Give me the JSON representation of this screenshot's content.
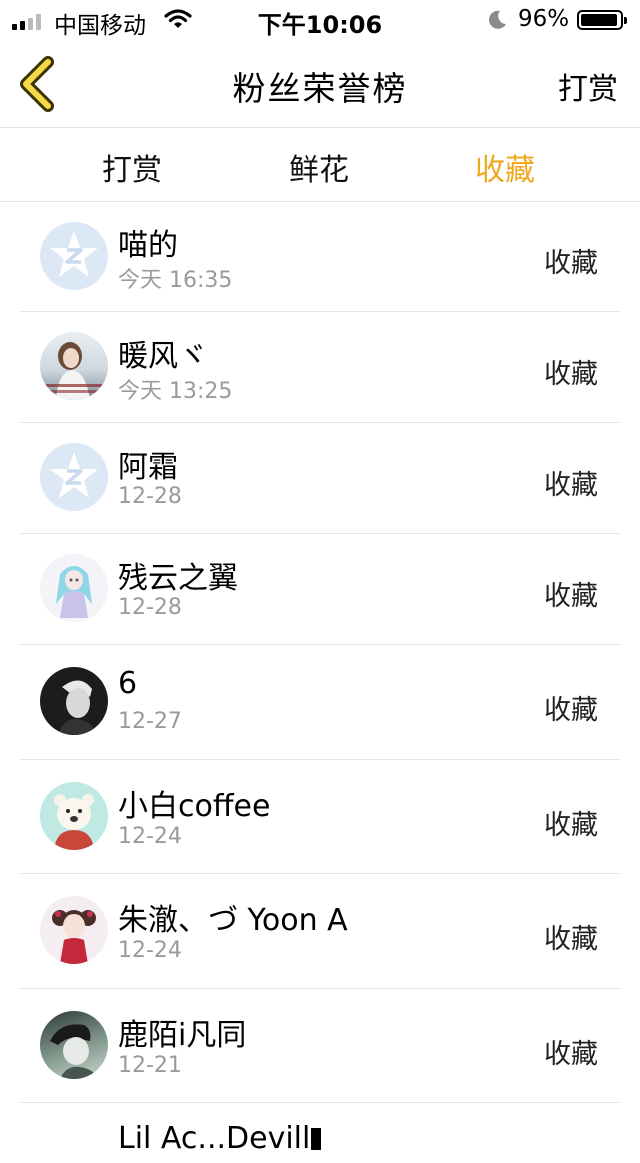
{
  "status_bar": {
    "carrier": "中国移动",
    "time": "下午10:06",
    "battery": "96%",
    "battery_level": 0.96,
    "icons": [
      "signal-icon",
      "wifi-icon",
      "moon-icon",
      "battery-icon"
    ]
  },
  "nav": {
    "title": "粉丝荣誉榜",
    "right_label": "打赏",
    "back_icon": "chevron-left-icon",
    "accent": "#f0a820"
  },
  "tabs": [
    {
      "label": "打赏",
      "active": false
    },
    {
      "label": "鲜花",
      "active": false
    },
    {
      "label": "收藏",
      "active": true
    }
  ],
  "list": [
    {
      "name": "喵的",
      "time": "今天 16:35",
      "action": "收藏",
      "avatar": "default-avatar-icon"
    },
    {
      "name": "暖风ヾ",
      "time": "今天 13:25",
      "action": "收藏",
      "avatar": "photo-avatar"
    },
    {
      "name": "阿霜",
      "time": "12-28",
      "action": "收藏",
      "avatar": "default-avatar-icon"
    },
    {
      "name": "残云之翼",
      "time": "12-28",
      "action": "收藏",
      "avatar": "anime-avatar"
    },
    {
      "name": "6",
      "time": "12-27",
      "action": "收藏",
      "avatar": "photo-avatar"
    },
    {
      "name": "小白coffee",
      "time": "12-24",
      "action": "收藏",
      "avatar": "bear-avatar"
    },
    {
      "name": "朱澈、づ Yoon A",
      "time": "12-24",
      "action": "收藏",
      "avatar": "anime-avatar"
    },
    {
      "name": "鹿陌i凡同",
      "time": "12-21",
      "action": "收藏",
      "avatar": "photo-avatar"
    },
    {
      "name": "Lil Ac...Devill",
      "time": "",
      "action": "",
      "avatar": ""
    }
  ]
}
